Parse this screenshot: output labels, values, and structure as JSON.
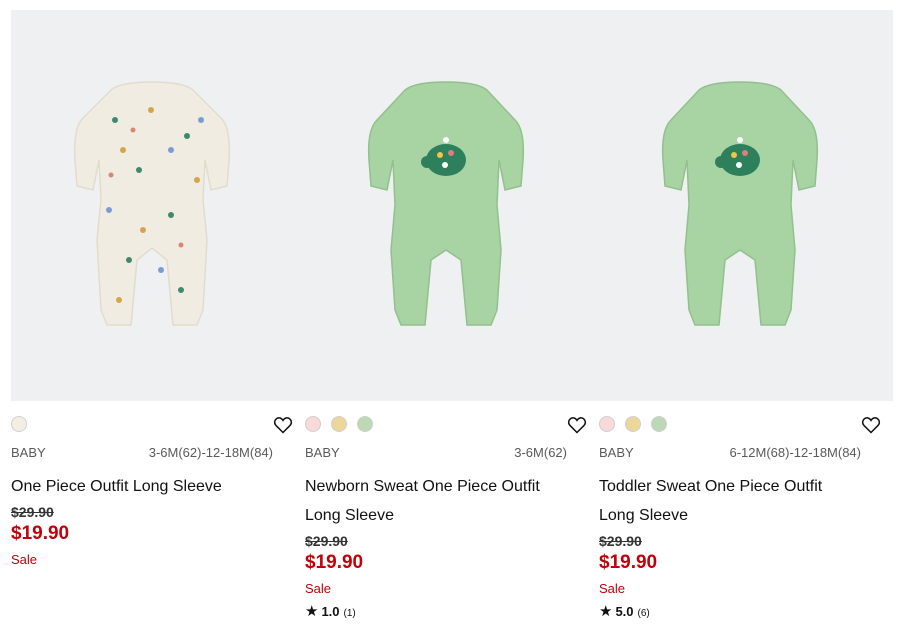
{
  "products": [
    {
      "category": "BABY",
      "sizes": "3-6M(62)-12-18M(84)",
      "title_lines": [
        "One Piece Outfit Long Sleeve"
      ],
      "old_price": "$29.90",
      "new_price": "$19.90",
      "sale_label": "Sale",
      "swatches": [
        "#f4eee2"
      ],
      "image_icon": "patterned-cream-onesie",
      "garment_color": "#efe9dc"
    },
    {
      "category": "BABY",
      "sizes": "3-6M(62)",
      "title_lines": [
        "Newborn Sweat One Piece Outfit",
        "Long Sleeve"
      ],
      "old_price": "$29.90",
      "new_price": "$19.90",
      "sale_label": "Sale",
      "rating": "1.0",
      "rating_count": "(1)",
      "swatches": [
        "#f6d9d8",
        "#ecd79a",
        "#bcd9b5"
      ],
      "image_icon": "green-onesie-turtle",
      "garment_color": "#a8d3a3"
    },
    {
      "category": "BABY",
      "sizes": "6-12M(68)-12-18M(84)",
      "title_lines": [
        "Toddler Sweat One Piece Outfit",
        "Long Sleeve"
      ],
      "old_price": "$29.90",
      "new_price": "$19.90",
      "sale_label": "Sale",
      "rating": "5.0",
      "rating_count": "(6)",
      "swatches": [
        "#f6d9d8",
        "#ecd79a",
        "#bcd9b5"
      ],
      "image_icon": "green-onesie-turtle",
      "garment_color": "#a8d3a3"
    }
  ],
  "colors": {
    "sale_red": "#c0000b",
    "image_bg": "#eef0f1"
  }
}
